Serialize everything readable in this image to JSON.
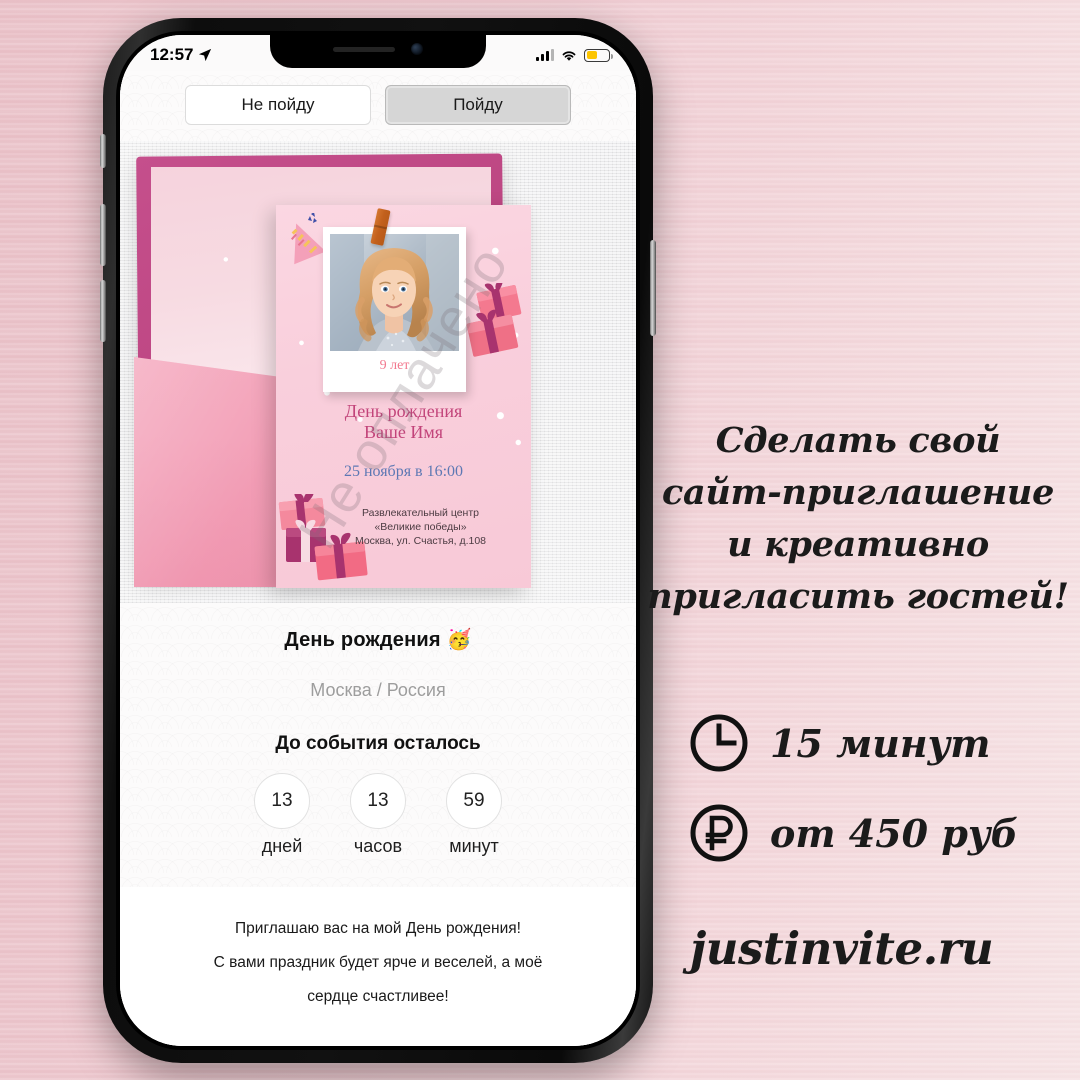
{
  "background": {
    "color": "#eec8cf"
  },
  "phone": {
    "status_bar": {
      "time": "12:57",
      "location_icon": "location-arrow-icon",
      "signal_icon": "cellular-signal-icon",
      "wifi_icon": "wifi-icon",
      "battery_icon": "battery-low-power-icon",
      "battery_color": "#fdc500"
    },
    "rsvp": {
      "decline_label": "Не пойду",
      "accept_label": "Пойду"
    },
    "invitation_card": {
      "watermark": "Не оплачено",
      "photo_caption": "9 лет",
      "title_line1": "День рождения",
      "title_line2": "Ваше Имя",
      "date": "25 ноября в 16:00",
      "venue_line1": "Развлекательный центр",
      "venue_line2": "«Великие победы»",
      "venue_line3": "Москва, ул. Счастья, д.108",
      "title_color": "#c2447a",
      "date_color": "#5d78b4",
      "age_color": "#f2798f"
    },
    "event": {
      "title": "День рождения",
      "title_emoji": "🥳",
      "location": "Москва / Россия",
      "countdown_label": "До события осталось",
      "countdown": [
        {
          "value": "13",
          "label": "дней"
        },
        {
          "value": "13",
          "label": "часов"
        },
        {
          "value": "59",
          "label": "минут"
        }
      ]
    },
    "footer_message": {
      "line1": "Приглашаю вас на мой День рождения!",
      "line2": "С вами праздник будет ярче и веселей, а моё",
      "line3": "сердце счастливее!"
    }
  },
  "promo": {
    "headline_line1": "Сделать свой",
    "headline_line2": "сайт-приглашение",
    "headline_line3": "и креативно",
    "headline_line4": "пригласить гостей!",
    "features": [
      {
        "icon": "clock-icon",
        "text": "15 минут"
      },
      {
        "icon": "ruble-circle-icon",
        "text": "от 450 руб"
      }
    ],
    "url": "justinvite.ru"
  }
}
